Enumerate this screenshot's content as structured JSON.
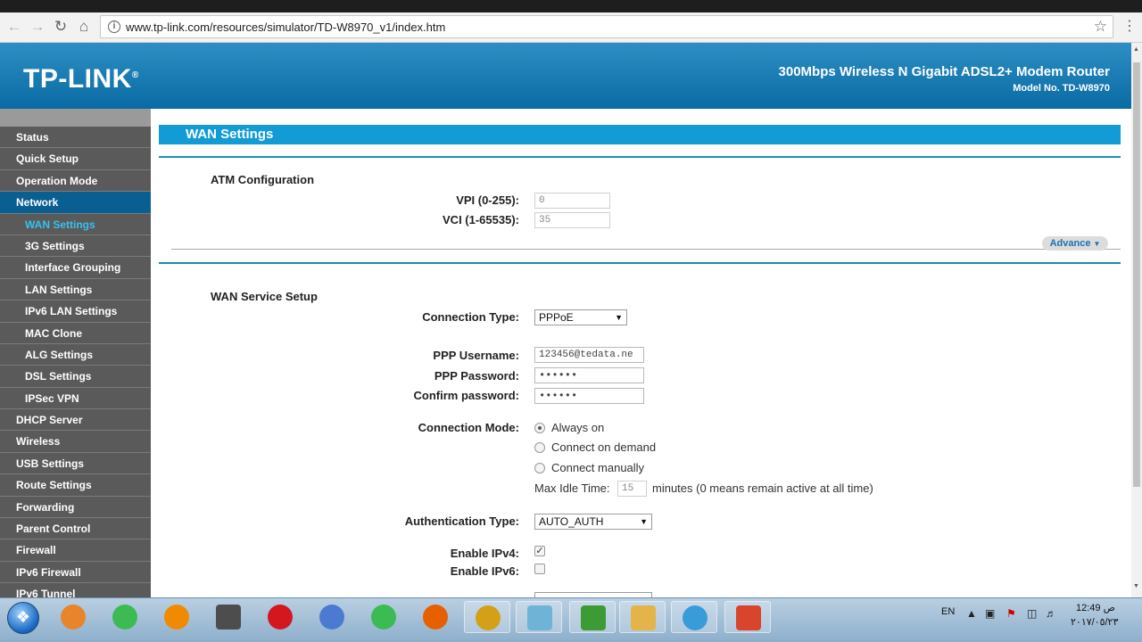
{
  "browser": {
    "url": "www.tp-link.com/resources/simulator/TD-W8970_v1/index.htm",
    "back_icon": "arrow-left-icon",
    "forward_icon": "arrow-right-icon",
    "reload_icon": "reload-icon",
    "home_icon": "home-icon"
  },
  "header": {
    "logo": "TP-LINK",
    "logo_mark": "®",
    "product": "300Mbps Wireless N Gigabit ADSL2+ Modem Router",
    "model": "Model No. TD-W8970"
  },
  "sidebar": {
    "items": [
      {
        "label": "Status",
        "level": 0
      },
      {
        "label": "Quick Setup",
        "level": 0
      },
      {
        "label": "Operation Mode",
        "level": 0
      },
      {
        "label": "Network",
        "level": 0,
        "active": true
      },
      {
        "label": "WAN Settings",
        "level": 1,
        "current": true
      },
      {
        "label": "3G Settings",
        "level": 1
      },
      {
        "label": "Interface Grouping",
        "level": 1
      },
      {
        "label": "LAN Settings",
        "level": 1
      },
      {
        "label": "IPv6 LAN Settings",
        "level": 1
      },
      {
        "label": "MAC Clone",
        "level": 1
      },
      {
        "label": "ALG Settings",
        "level": 1
      },
      {
        "label": "DSL Settings",
        "level": 1
      },
      {
        "label": "IPSec VPN",
        "level": 1
      },
      {
        "label": "DHCP Server",
        "level": 0
      },
      {
        "label": "Wireless",
        "level": 0
      },
      {
        "label": "USB Settings",
        "level": 0
      },
      {
        "label": "Route Settings",
        "level": 0
      },
      {
        "label": "Forwarding",
        "level": 0
      },
      {
        "label": "Parent Control",
        "level": 0
      },
      {
        "label": "Firewall",
        "level": 0
      },
      {
        "label": "IPv6 Firewall",
        "level": 0
      },
      {
        "label": "IPv6 Tunnel",
        "level": 0
      }
    ]
  },
  "main": {
    "title": "WAN Settings",
    "atm": {
      "title": "ATM Configuration",
      "vpi_label": "VPI (0-255):",
      "vpi_value": "0",
      "vci_label": "VCI (1-65535):",
      "vci_value": "35",
      "advance_label": "Advance"
    },
    "wan": {
      "title": "WAN Service Setup",
      "conn_type_label": "Connection Type:",
      "conn_type_value": "PPPoE",
      "username_label": "PPP Username:",
      "username_value": "123456@tedata.ne",
      "password_label": "PPP Password:",
      "password_value": "••••••",
      "confirm_label": "Confirm password:",
      "confirm_value": "••••••",
      "conn_mode_label": "Connection Mode:",
      "mode_always": "Always on",
      "mode_demand": "Connect on demand",
      "mode_manual": "Connect manually",
      "idle_label": "Max Idle Time:",
      "idle_value": "15",
      "idle_note": "minutes (0 means remain active at all time)",
      "auth_label": "Authentication Type:",
      "auth_value": "AUTO_AUTH",
      "ipv4_label": "Enable IPv4:",
      "ipv4_checked": true,
      "ipv6_label": "Enable IPv6:",
      "ipv6_checked": false
    }
  },
  "taskbar": {
    "lang": "EN",
    "time": "12:49 ص",
    "date": "٢٠١٧/٠٥/٢٣",
    "apps": [
      "media-player-icon",
      "chrome-icon",
      "vlc-icon",
      "sublime-icon",
      "opera-icon",
      "chromium-icon",
      "chrome-icon",
      "firefox-icon",
      "chrome-canary-icon",
      "notepad-icon",
      "camtasia-icon",
      "file-explorer-icon",
      "hd-player-icon",
      "camtasia-recorder-icon"
    ]
  }
}
